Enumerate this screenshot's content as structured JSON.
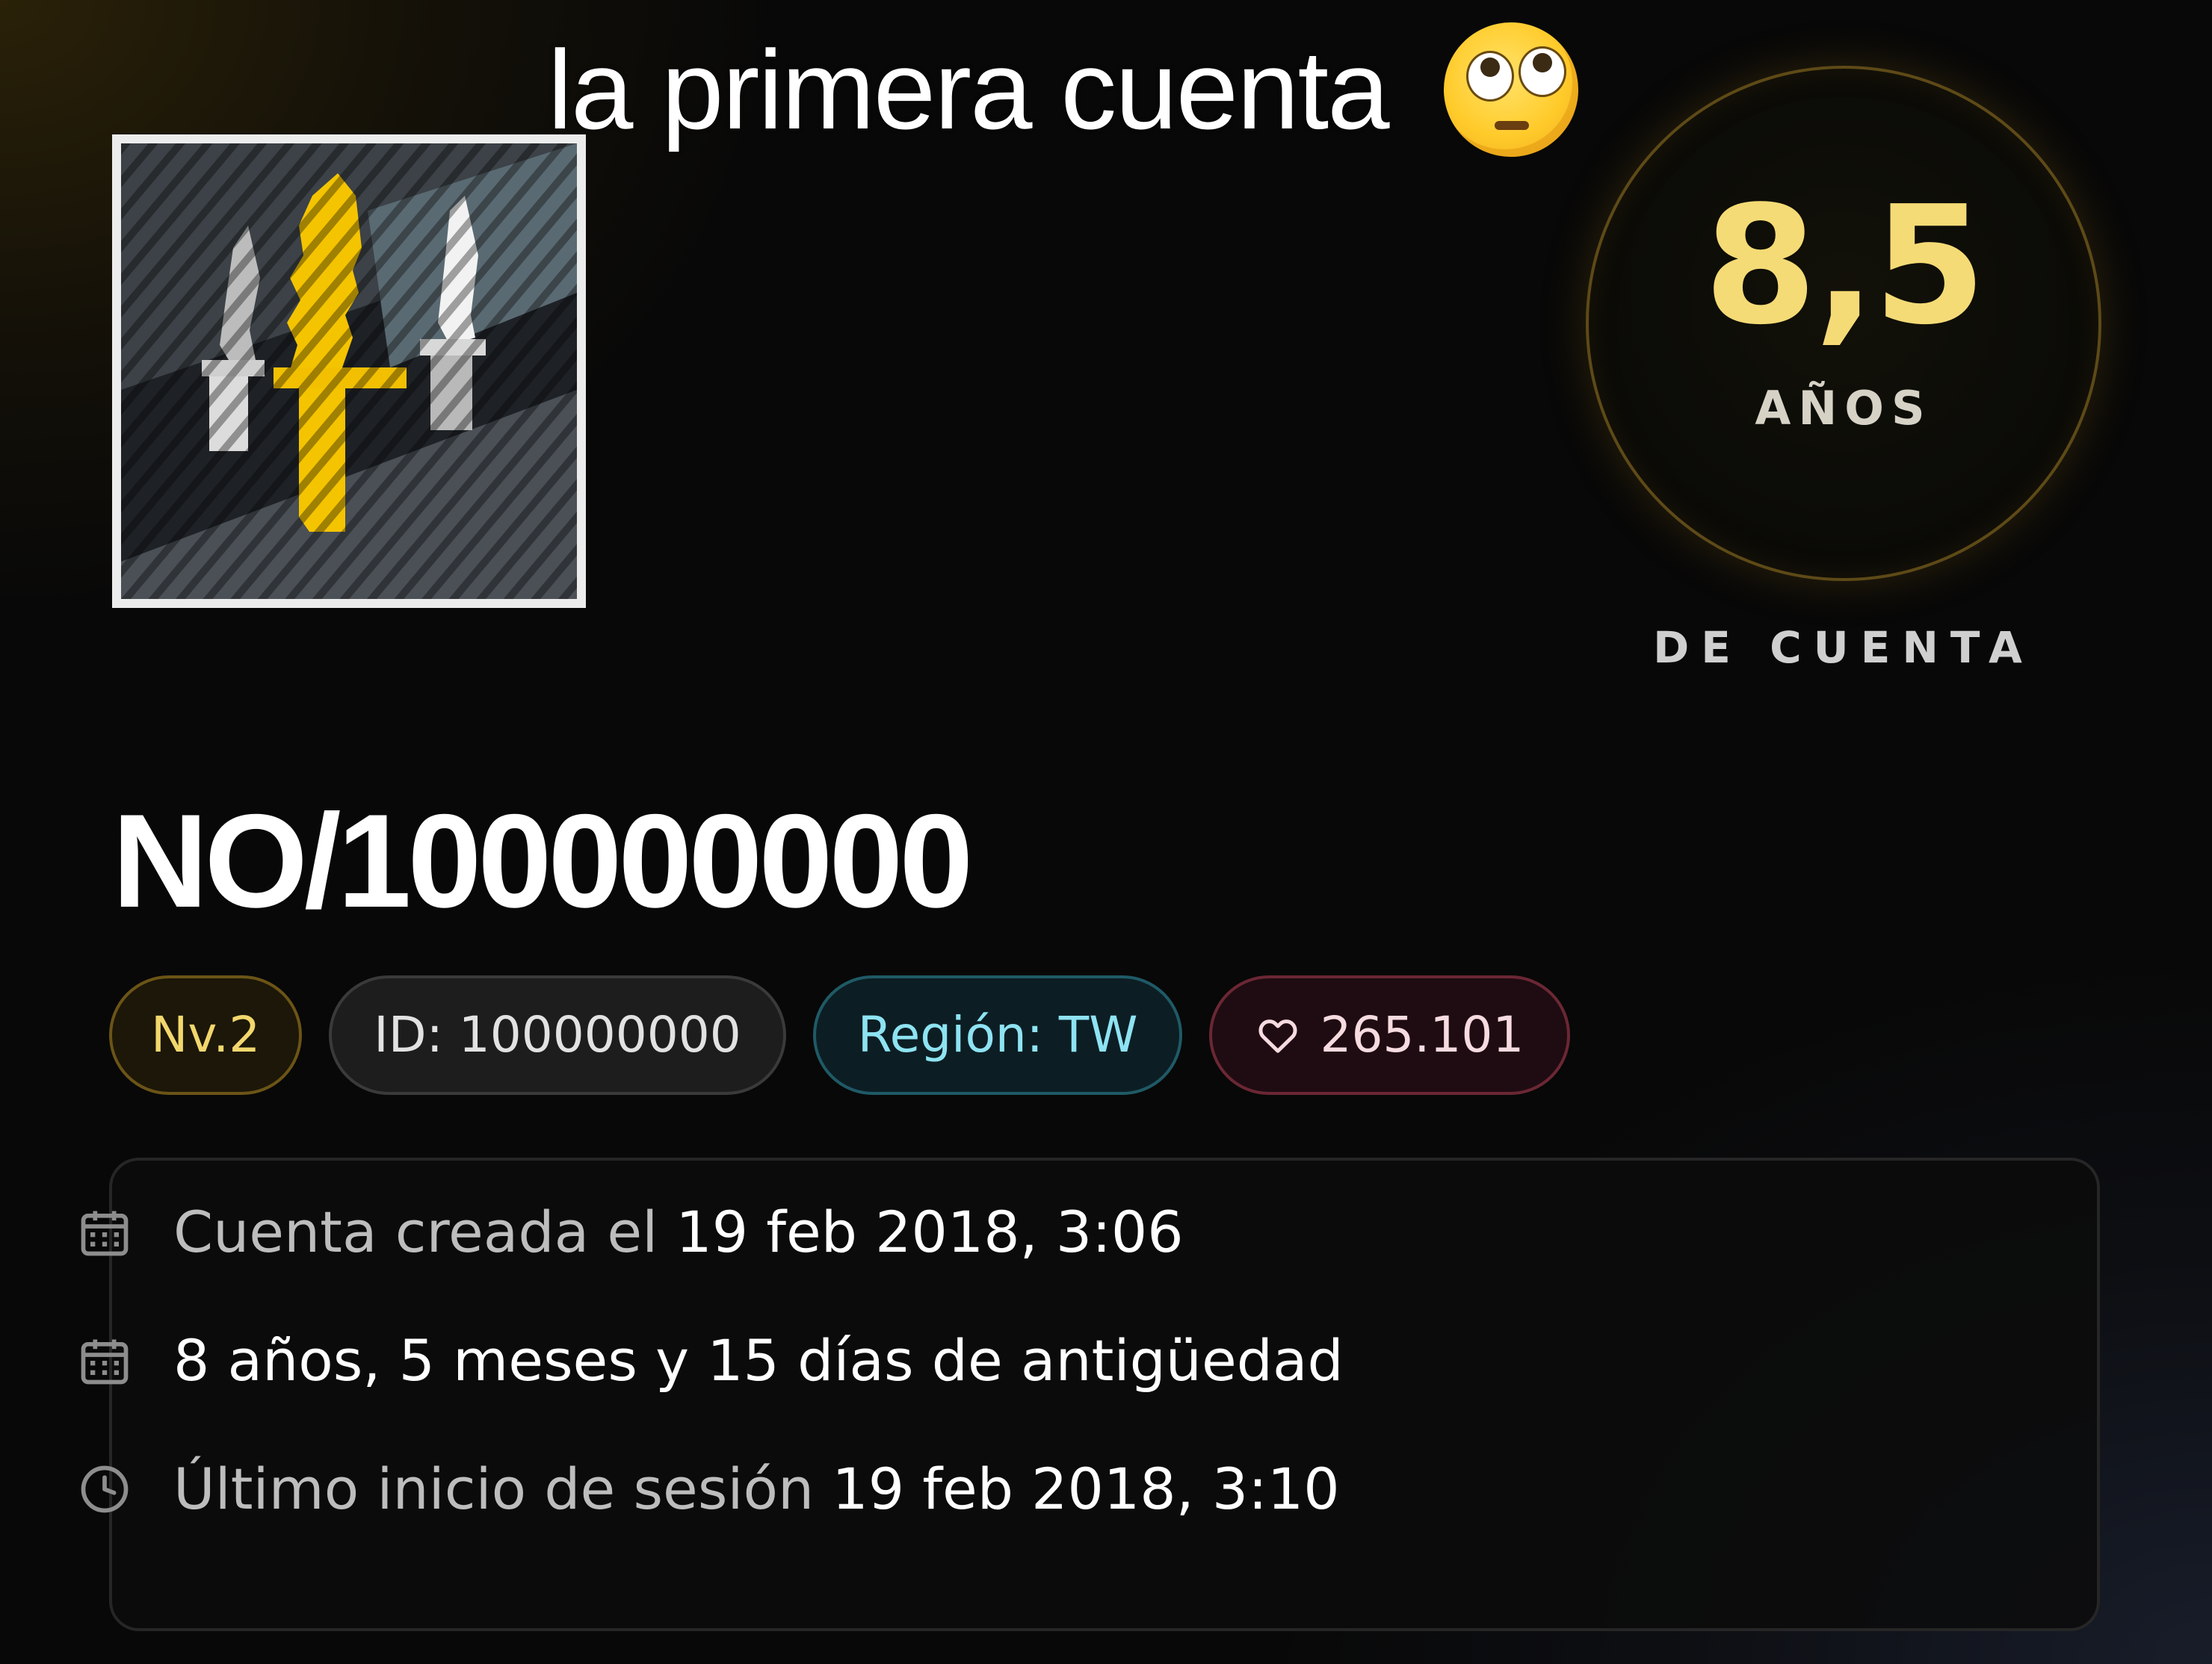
{
  "caption": {
    "text": "la primera cuenta",
    "emoji": "flushed-face-emoji"
  },
  "avatar": {
    "icon": "yellow-knife-icon",
    "colors": {
      "knife": "#f5c400",
      "frame": "#ececec"
    }
  },
  "account_age": {
    "value": "8,5",
    "unit": "AÑOS",
    "caption": "DE CUENTA",
    "accent_color": "#f5db76"
  },
  "profile": {
    "username": "NO/100000000"
  },
  "badges": {
    "level": "Nv.2",
    "id": "ID: 100000000",
    "region": "Región: TW",
    "likes": "265.101",
    "likes_icon": "heart-icon"
  },
  "details": {
    "created": {
      "icon": "calendar-icon",
      "label": "Cuenta creada el",
      "value": "19 feb 2018, 3:06"
    },
    "age": {
      "icon": "calendar-icon",
      "text": "8 años, 5 meses y 15 días de antigüedad"
    },
    "last_login": {
      "icon": "clock-icon",
      "label": "Último inicio de sesión",
      "value": "19 feb 2018, 3:10"
    }
  }
}
